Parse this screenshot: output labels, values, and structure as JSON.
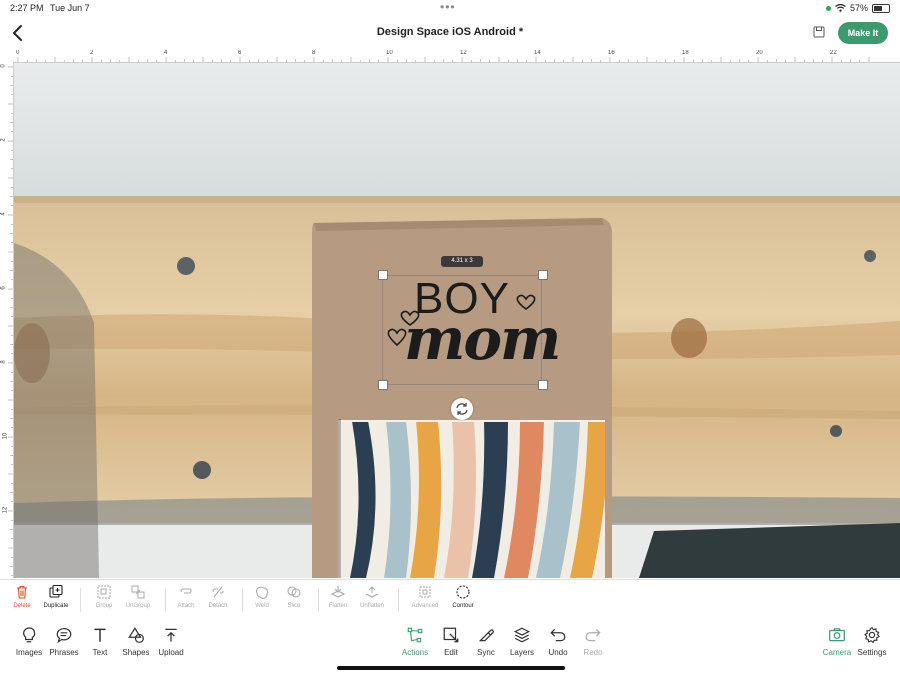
{
  "status": {
    "time": "2:27 PM",
    "date": "Tue Jun 7",
    "battery": "57%",
    "battery_level": 0.57
  },
  "header": {
    "title": "Design Space iOS Android *",
    "make_it": "Make It"
  },
  "ruler": {
    "top": [
      "0",
      "2",
      "4",
      "6",
      "8",
      "10",
      "12",
      "14",
      "16",
      "18",
      "20",
      "22"
    ],
    "left": [
      "0",
      "2",
      "4",
      "6",
      "8",
      "10",
      "12"
    ]
  },
  "canvas": {
    "size_label": "4.31 x 3",
    "design_line1": "BOY",
    "design_line2": "mom"
  },
  "edit_toolbar": [
    {
      "label": "Delete",
      "icon": "trash-icon",
      "state": "delete"
    },
    {
      "label": "Duplicate",
      "icon": "duplicate-icon",
      "state": "active"
    },
    {
      "label": "Group",
      "icon": "group-icon",
      "state": "disabled"
    },
    {
      "label": "UnGroup",
      "icon": "ungroup-icon",
      "state": "disabled"
    },
    {
      "label": "Attach",
      "icon": "attach-icon",
      "state": "disabled"
    },
    {
      "label": "Detach",
      "icon": "detach-icon",
      "state": "disabled"
    },
    {
      "label": "Weld",
      "icon": "weld-icon",
      "state": "disabled"
    },
    {
      "label": "Slice",
      "icon": "slice-icon",
      "state": "disabled"
    },
    {
      "label": "Flatten",
      "icon": "flatten-icon",
      "state": "disabled"
    },
    {
      "label": "Unflatten",
      "icon": "unflatten-icon",
      "state": "disabled"
    },
    {
      "label": "Advanced",
      "icon": "advanced-icon",
      "state": "disabled"
    },
    {
      "label": "Contour",
      "icon": "contour-icon",
      "state": "active"
    }
  ],
  "bottom_toolbar": {
    "left": [
      {
        "label": "Images",
        "icon": "lightbulb-icon"
      },
      {
        "label": "Phrases",
        "icon": "speech-bubble-icon"
      },
      {
        "label": "Text",
        "icon": "text-icon"
      },
      {
        "label": "Shapes",
        "icon": "shapes-icon"
      },
      {
        "label": "Upload",
        "icon": "upload-icon"
      }
    ],
    "center": [
      {
        "label": "Actions",
        "icon": "actions-icon",
        "state": "green"
      },
      {
        "label": "Edit",
        "icon": "edit-icon",
        "state": "normal"
      },
      {
        "label": "Sync",
        "icon": "sync-icon",
        "state": "normal"
      },
      {
        "label": "Layers",
        "icon": "layers-icon",
        "state": "normal"
      },
      {
        "label": "Undo",
        "icon": "undo-icon",
        "state": "normal"
      },
      {
        "label": "Redo",
        "icon": "redo-icon",
        "state": "disabled"
      }
    ],
    "right": [
      {
        "label": "Camera",
        "icon": "camera-icon",
        "state": "green"
      },
      {
        "label": "Settings",
        "icon": "gear-icon",
        "state": "normal"
      }
    ]
  },
  "colors": {
    "accent": "#3d9a6d",
    "delete": "#e24a2b"
  }
}
